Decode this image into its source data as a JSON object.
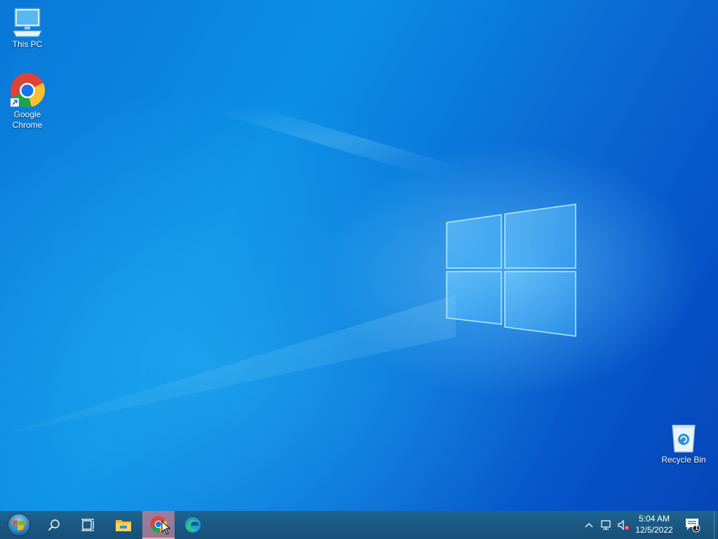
{
  "desktop": {
    "icons": [
      {
        "label": "This PC",
        "icon": "computer-icon"
      },
      {
        "label": "Google\nChrome",
        "icon": "chrome-icon"
      },
      {
        "label": "Recycle Bin",
        "icon": "recycle-bin-icon"
      }
    ]
  },
  "taskbar": {
    "buttons": [
      {
        "name": "start",
        "icon": "windows-start-orb-icon"
      },
      {
        "name": "search",
        "icon": "search-icon"
      },
      {
        "name": "task-view",
        "icon": "task-view-icon"
      },
      {
        "name": "file-explorer",
        "icon": "folder-icon"
      },
      {
        "name": "google-chrome",
        "icon": "chrome-icon",
        "active": true
      },
      {
        "name": "microsoft-edge",
        "icon": "edge-icon"
      }
    ],
    "tray": {
      "chevron_icon": "chevron-up-icon",
      "network_icon": "network-icon",
      "volume_icon": "volume-muted-icon",
      "time": "5:04 AM",
      "date": "12/5/2022",
      "notification_count": "1"
    }
  },
  "colors": {
    "taskbar": "#1b5b86",
    "wallpaper_blue": "#0a78d8",
    "active_button": "#f2a6b3"
  }
}
